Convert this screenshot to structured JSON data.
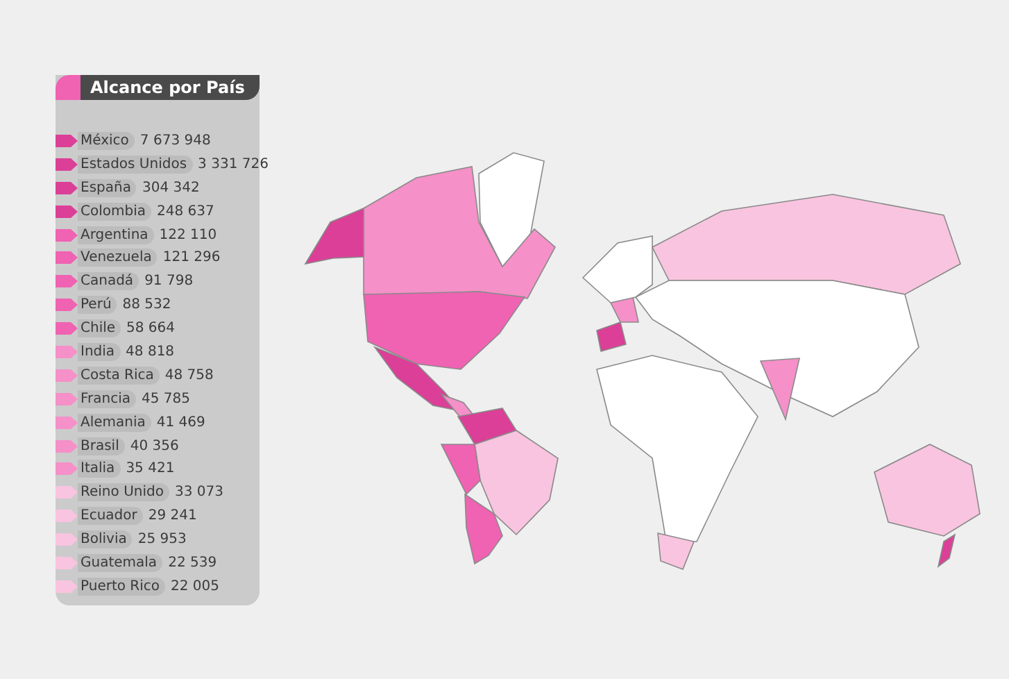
{
  "legend": {
    "title": "Alcance por País",
    "items": [
      {
        "country": "México",
        "value": "7 673 948",
        "color": "#dc3f97"
      },
      {
        "country": "Estados Unidos",
        "value": "3 331 726",
        "color": "#dc3f97"
      },
      {
        "country": "España",
        "value": "304 342",
        "color": "#dc3f97"
      },
      {
        "country": "Colombia",
        "value": "248 637",
        "color": "#dc3f97"
      },
      {
        "country": "Argentina",
        "value": "122 110",
        "color": "#f062b2"
      },
      {
        "country": "Venezuela",
        "value": "121 296",
        "color": "#f062b2"
      },
      {
        "country": "Canadá",
        "value": "91 798",
        "color": "#f062b2"
      },
      {
        "country": "Perú",
        "value": "88 532",
        "color": "#f062b2"
      },
      {
        "country": "Chile",
        "value": "58 664",
        "color": "#f062b2"
      },
      {
        "country": "India",
        "value": "48 818",
        "color": "#f590c8"
      },
      {
        "country": "Costa Rica",
        "value": "48 758",
        "color": "#f590c8"
      },
      {
        "country": "Francia",
        "value": "45 785",
        "color": "#f590c8"
      },
      {
        "country": "Alemania",
        "value": "41 469",
        "color": "#f590c8"
      },
      {
        "country": "Brasil",
        "value": "40 356",
        "color": "#f590c8"
      },
      {
        "country": "Italia",
        "value": "35 421",
        "color": "#f590c8"
      },
      {
        "country": "Reino Unido",
        "value": "33 073",
        "color": "#f9c4df"
      },
      {
        "country": "Ecuador",
        "value": "29 241",
        "color": "#f9c4df"
      },
      {
        "country": "Bolivia",
        "value": "25 953",
        "color": "#f9c4df"
      },
      {
        "country": "Guatemala",
        "value": "22 539",
        "color": "#f9c4df"
      },
      {
        "country": "Puerto Rico",
        "value": "22 005",
        "color": "#f9c4df"
      }
    ]
  }
}
